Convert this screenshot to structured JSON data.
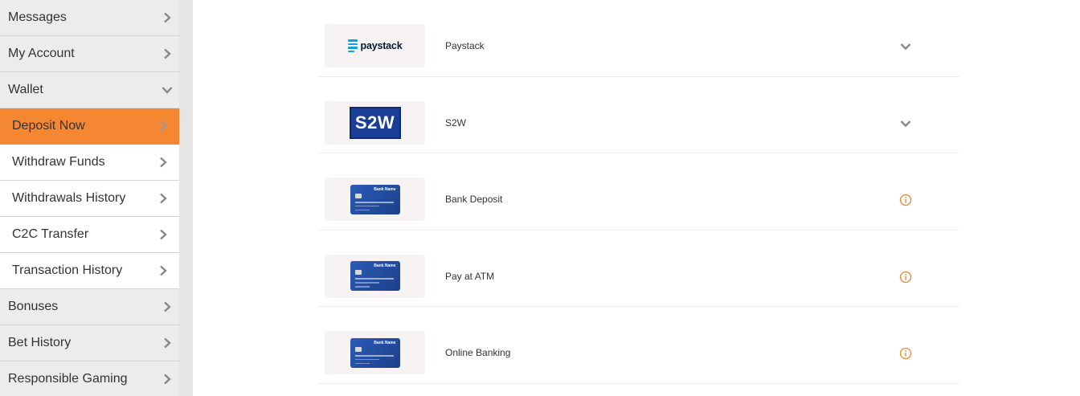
{
  "sidebar": {
    "items": [
      {
        "label": "Messages",
        "kind": "top",
        "icon": "chevron-right-icon"
      },
      {
        "label": "My Account",
        "kind": "top",
        "icon": "chevron-right-icon"
      },
      {
        "label": "Wallet",
        "kind": "top",
        "icon": "chevron-down-icon"
      },
      {
        "label": "Deposit Now",
        "kind": "sub",
        "active": true,
        "icon": "chevron-right-icon"
      },
      {
        "label": "Withdraw Funds",
        "kind": "sub",
        "icon": "chevron-right-icon"
      },
      {
        "label": "Withdrawals History",
        "kind": "sub",
        "icon": "chevron-right-icon"
      },
      {
        "label": "C2C Transfer",
        "kind": "sub",
        "icon": "chevron-right-icon"
      },
      {
        "label": "Transaction History",
        "kind": "sub",
        "icon": "chevron-right-icon"
      },
      {
        "label": "Bonuses",
        "kind": "top",
        "icon": "chevron-right-icon"
      },
      {
        "label": "Bet History",
        "kind": "top",
        "icon": "chevron-right-icon"
      },
      {
        "label": "Responsible Gaming",
        "kind": "top",
        "icon": "chevron-right-icon"
      }
    ],
    "active_color": "#f58733"
  },
  "deposit_methods": [
    {
      "name": "Paystack",
      "logo_text": "paystack",
      "logo": "paystack-logo",
      "action_icon": "chevron-down-icon"
    },
    {
      "name": "S2W",
      "logo_text": "S2W",
      "logo": "s2w-logo",
      "action_icon": "chevron-down-icon"
    },
    {
      "name": "Bank Deposit",
      "logo_text": "Bank Name",
      "logo": "bank-card-logo",
      "action_icon": "info-icon"
    },
    {
      "name": "Pay at ATM",
      "logo_text": "Bank Name",
      "logo": "bank-card-logo",
      "action_icon": "info-icon"
    },
    {
      "name": "Online Banking",
      "logo_text": "Bank Name",
      "logo": "bank-card-logo",
      "action_icon": "info-icon"
    }
  ],
  "colors": {
    "accent": "#f58733",
    "info_icon": "#e8872c",
    "paystack_blue": "#09a5db",
    "s2w_blue": "#1a3d96"
  }
}
